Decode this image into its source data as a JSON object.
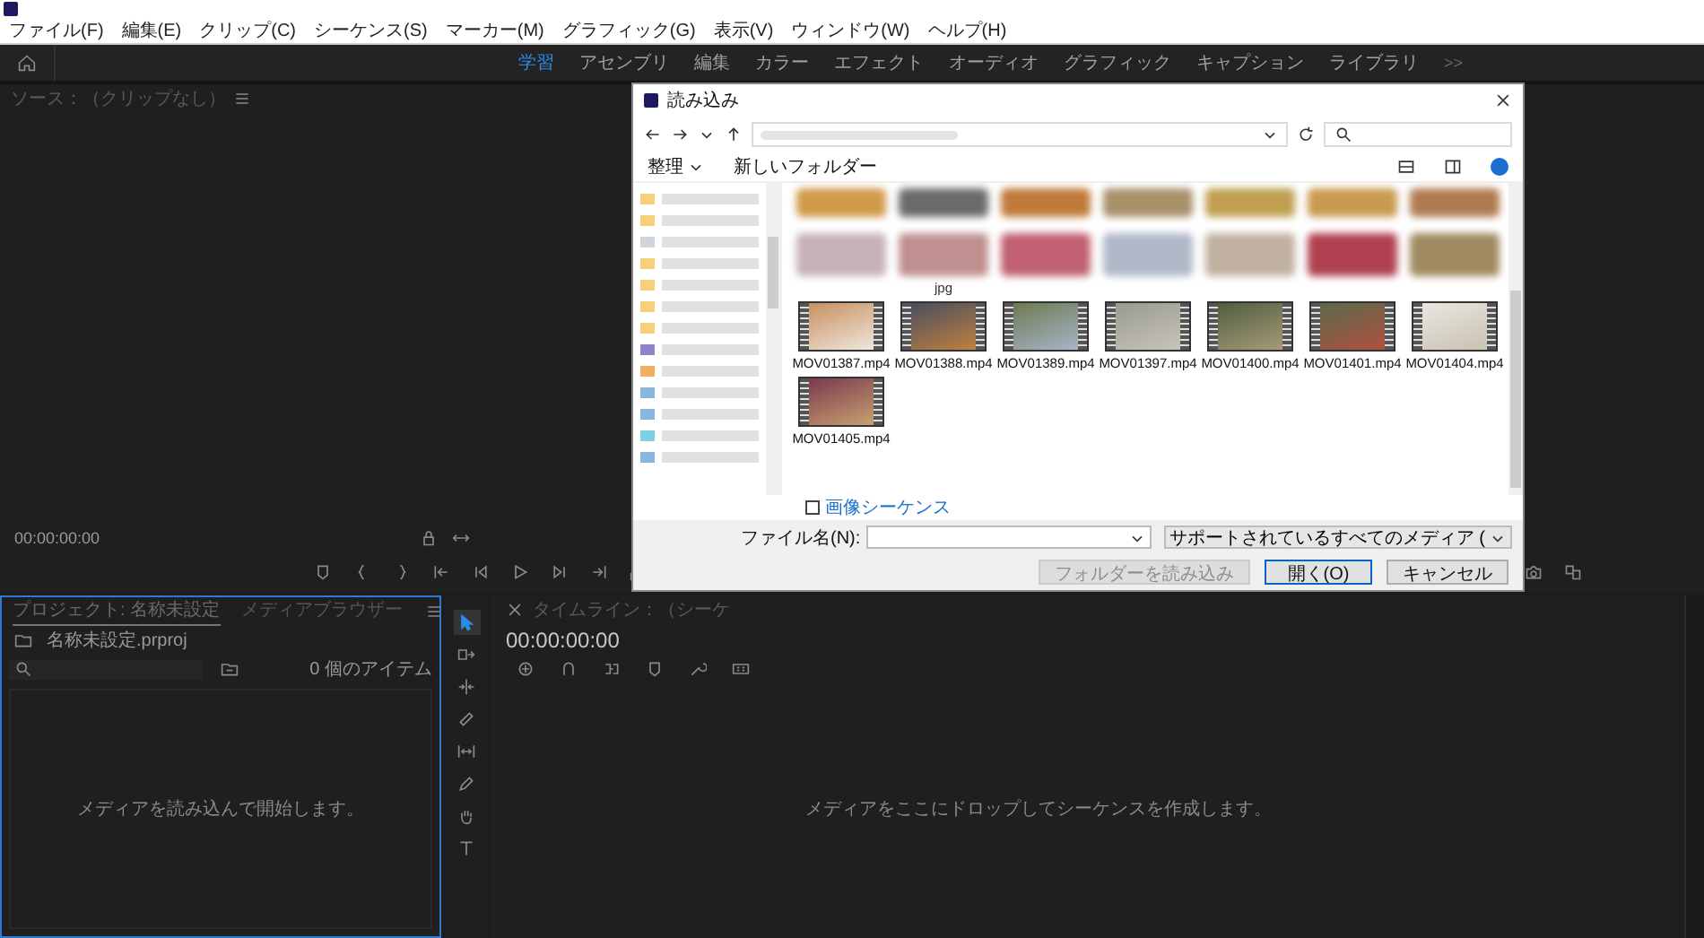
{
  "menu_bar": [
    "ファイル(F)",
    "編集(E)",
    "クリップ(C)",
    "シーケンス(S)",
    "マーカー(M)",
    "グラフィック(G)",
    "表示(V)",
    "ウィンドウ(W)",
    "ヘルプ(H)"
  ],
  "workspaces": [
    {
      "label": "学習",
      "selected": true
    },
    {
      "label": "アセンブリ",
      "selected": false
    },
    {
      "label": "編集",
      "selected": false
    },
    {
      "label": "カラー",
      "selected": false
    },
    {
      "label": "エフェクト",
      "selected": false
    },
    {
      "label": "オーディオ",
      "selected": false
    },
    {
      "label": "グラフィック",
      "selected": false
    },
    {
      "label": "キャプション",
      "selected": false
    },
    {
      "label": "ライブラリ",
      "selected": false
    }
  ],
  "workspace_overflow": ">>",
  "source_panel": {
    "title": "ソース：（クリップなし）",
    "timecode": "00:00:00:00"
  },
  "project_panel": {
    "tabs": [
      {
        "label": "プロジェクト: 名称未設定",
        "selected": true
      },
      {
        "label": "メディアブラウザー",
        "selected": false
      }
    ],
    "file": "名称未設定.prproj",
    "item_count": "0 個のアイテム",
    "empty_message": "メディアを読み込んで開始します。"
  },
  "tools": [
    {
      "kind": "selection",
      "selected": true
    },
    {
      "kind": "track-select",
      "selected": false
    },
    {
      "kind": "ripple",
      "selected": false
    },
    {
      "kind": "razor",
      "selected": false
    },
    {
      "kind": "slip",
      "selected": false
    },
    {
      "kind": "pen",
      "selected": false
    },
    {
      "kind": "hand",
      "selected": false
    },
    {
      "kind": "type",
      "selected": false
    }
  ],
  "timeline": {
    "title": "タイムライン：（シーケ",
    "timecode": "00:00:00:00",
    "empty_message": "メディアをここにドロップしてシーケンスを作成します。"
  },
  "dialog": {
    "title": "読み込み",
    "toolbar": [
      "整理",
      "新しいフォルダー"
    ],
    "files": [
      {
        "kind": "blurred"
      },
      {
        "kind": "blurred"
      },
      {
        "kind": "blurred"
      },
      {
        "kind": "blurred"
      },
      {
        "kind": "blurred"
      },
      {
        "kind": "blurred"
      },
      {
        "kind": "blurred"
      },
      {
        "kind": "blurred"
      },
      {
        "kind": "blurred",
        "name": "jpg"
      },
      {
        "kind": "blurred"
      },
      {
        "kind": "blurred"
      },
      {
        "kind": "blurred"
      },
      {
        "kind": "blurred"
      },
      {
        "kind": "blurred"
      },
      {
        "kind": "video",
        "name": "MOV01387.mp4"
      },
      {
        "kind": "video",
        "name": "MOV01388.mp4"
      },
      {
        "kind": "video",
        "name": "MOV01389.mp4"
      },
      {
        "kind": "video",
        "name": "MOV01397.mp4"
      },
      {
        "kind": "video",
        "name": "MOV01400.mp4"
      },
      {
        "kind": "video",
        "name": "MOV01401.mp4"
      },
      {
        "kind": "video",
        "name": "MOV01404.mp4"
      },
      {
        "kind": "video",
        "name": "MOV01405.mp4"
      }
    ],
    "image_sequence": {
      "label": "画像シーケンス",
      "checked": false
    },
    "file_name_label": "ファイル名(N):",
    "file_type": "サポートされているすべてのメディア (",
    "buttons": [
      {
        "label": "フォルダーを読み込み",
        "disabled": true,
        "focused": false
      },
      {
        "label": "開く(O)",
        "disabled": false,
        "focused": true
      },
      {
        "label": "キャンセル",
        "disabled": false,
        "focused": false
      }
    ]
  }
}
